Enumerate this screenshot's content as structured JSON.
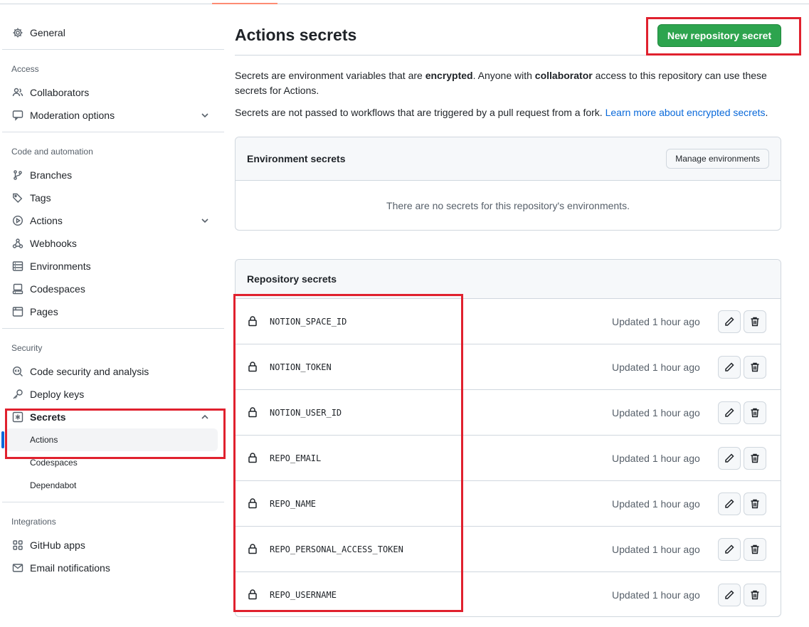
{
  "sidebar": {
    "general": "General",
    "access_head": "Access",
    "collaborators": "Collaborators",
    "moderation": "Moderation options",
    "code_head": "Code and automation",
    "branches": "Branches",
    "tags": "Tags",
    "actions": "Actions",
    "webhooks": "Webhooks",
    "environments": "Environments",
    "codespaces": "Codespaces",
    "pages": "Pages",
    "security_head": "Security",
    "code_security": "Code security and analysis",
    "deploy_keys": "Deploy keys",
    "secrets": "Secrets",
    "secrets_sub": [
      "Actions",
      "Codespaces",
      "Dependabot"
    ],
    "integrations_head": "Integrations",
    "github_apps": "GitHub apps",
    "email_notifications": "Email notifications"
  },
  "main": {
    "title": "Actions secrets",
    "new_secret_button": "New repository secret",
    "desc1_a": "Secrets are environment variables that are ",
    "desc1_b": "encrypted",
    "desc1_c": ". Anyone with ",
    "desc1_d": "collaborator",
    "desc1_e": " access to this repository can use these secrets for Actions.",
    "desc2_a": "Secrets are not passed to workflows that are triggered by a pull request from a fork. ",
    "desc2_link": "Learn more about encrypted secrets",
    "desc2_end": ".",
    "env_box": {
      "title": "Environment secrets",
      "manage_button": "Manage environments",
      "empty": "There are no secrets for this repository's environments."
    },
    "repo_box": {
      "title": "Repository secrets",
      "secrets": [
        {
          "name": "NOTION_SPACE_ID",
          "updated": "Updated 1 hour ago"
        },
        {
          "name": "NOTION_TOKEN",
          "updated": "Updated 1 hour ago"
        },
        {
          "name": "NOTION_USER_ID",
          "updated": "Updated 1 hour ago"
        },
        {
          "name": "REPO_EMAIL",
          "updated": "Updated 1 hour ago"
        },
        {
          "name": "REPO_NAME",
          "updated": "Updated 1 hour ago"
        },
        {
          "name": "REPO_PERSONAL_ACCESS_TOKEN",
          "updated": "Updated 1 hour ago"
        },
        {
          "name": "REPO_USERNAME",
          "updated": "Updated 1 hour ago"
        }
      ]
    }
  },
  "colors": {
    "primary_button": "#2da44e",
    "link": "#0969da",
    "annotation": "#e0212e",
    "active_indicator": "#0969da"
  }
}
